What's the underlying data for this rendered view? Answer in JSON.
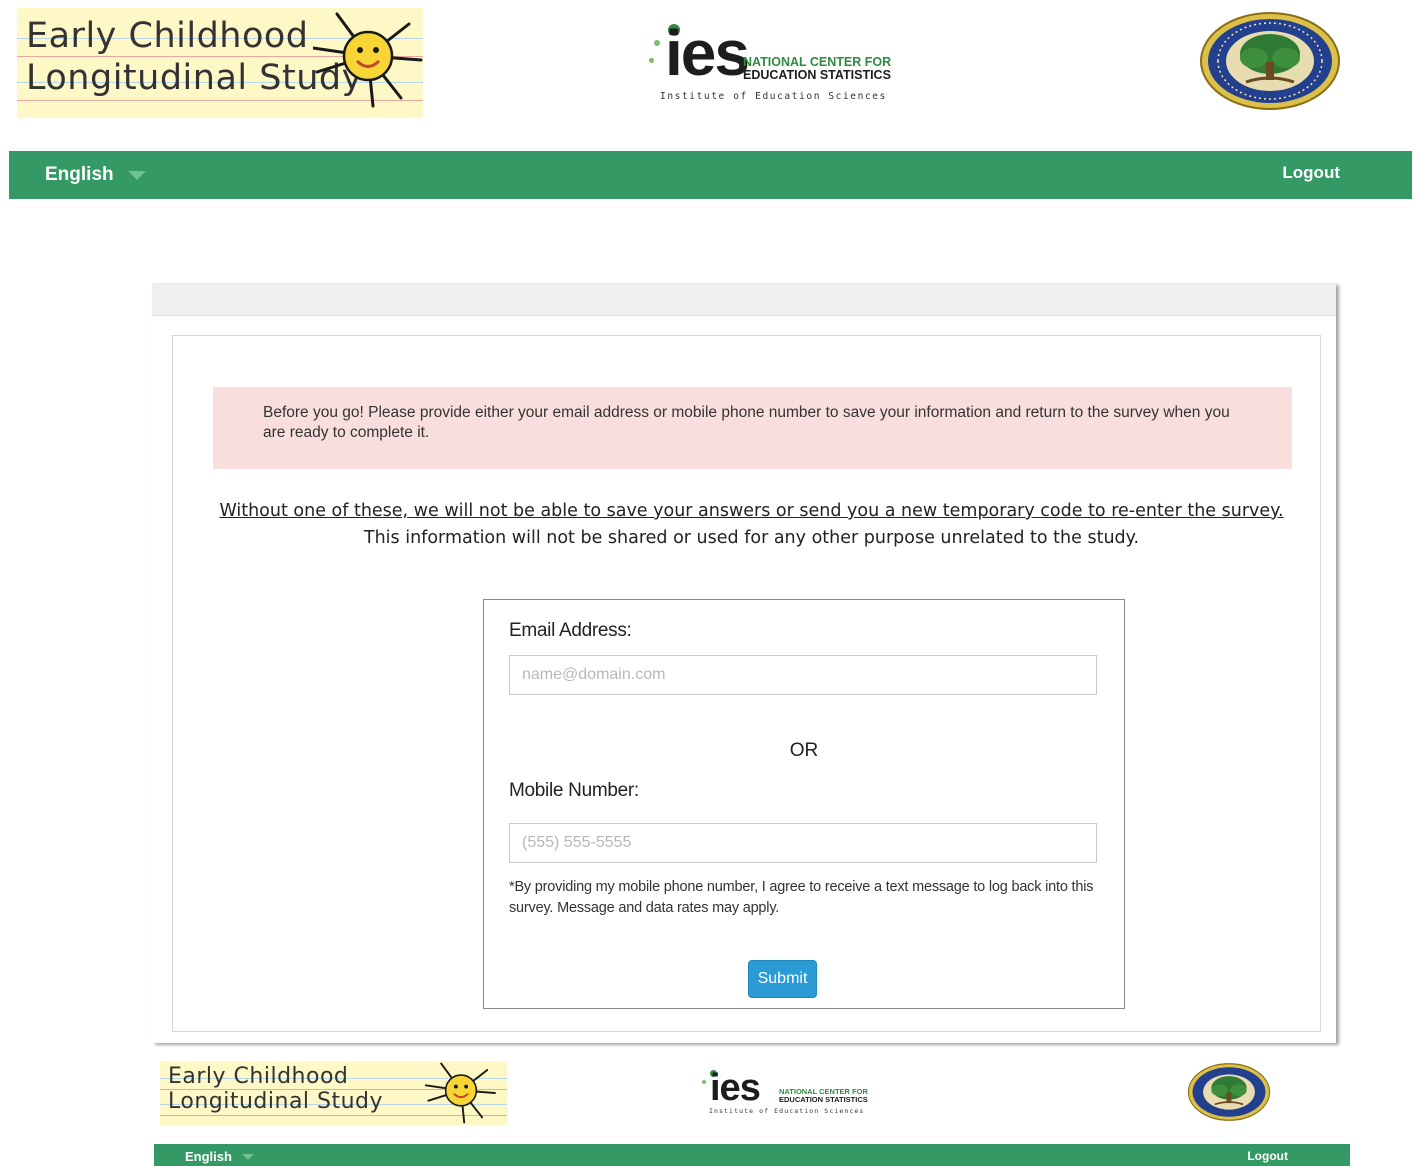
{
  "header": {
    "ecls_logo": {
      "line1": "Early Childhood",
      "line2": "Longitudinal Study",
      "icon": "sun-icon"
    },
    "ies_logo": {
      "word": "ies",
      "nces_line1": "NATIONAL CENTER FOR",
      "nces_line2": "EDUCATION STATISTICS",
      "subtitle": "Institute of Education Sciences"
    },
    "seal": {
      "icon": "department-of-education-seal",
      "text": "DEPARTMENT OF EDUCATION · UNITED STATES OF AMERICA"
    }
  },
  "nav": {
    "language": "English",
    "logout": "Logout"
  },
  "main": {
    "alert": "Before you go! Please provide either your email address or mobile phone number to save your information and return to the survey when you are ready to complete it.",
    "notice_underlined": "Without one of these, we will not be able to save your answers or send you a new temporary code to re-enter the survey.",
    "notice_plain": "This information will not be shared or used for any other purpose unrelated to the study.",
    "form": {
      "email_label": "Email Address:",
      "email_placeholder": "name@domain.com",
      "email_value": "",
      "or_text": "OR",
      "mobile_label": "Mobile Number:",
      "mobile_placeholder": "(555) 555-5555",
      "mobile_value": "",
      "disclaimer": "*By providing my mobile phone number, I agree to receive a text message to log back into this survey. Message and data rates may apply.",
      "submit_label": "Submit"
    }
  },
  "footer": {
    "ecls_logo": {
      "line1": "Early Childhood",
      "line2": "Longitudinal Study"
    },
    "ies_logo": {
      "word": "ies",
      "nces_line1": "NATIONAL CENTER FOR",
      "nces_line2": "EDUCATION STATISTICS",
      "subtitle": "Institute of Education Sciences"
    },
    "language": "English",
    "logout": "Logout"
  },
  "colors": {
    "nav_green": "#349965",
    "alert_pink": "#f9dede",
    "submit_blue": "#2b9bd6",
    "logo_cream": "#fdf8c6"
  }
}
